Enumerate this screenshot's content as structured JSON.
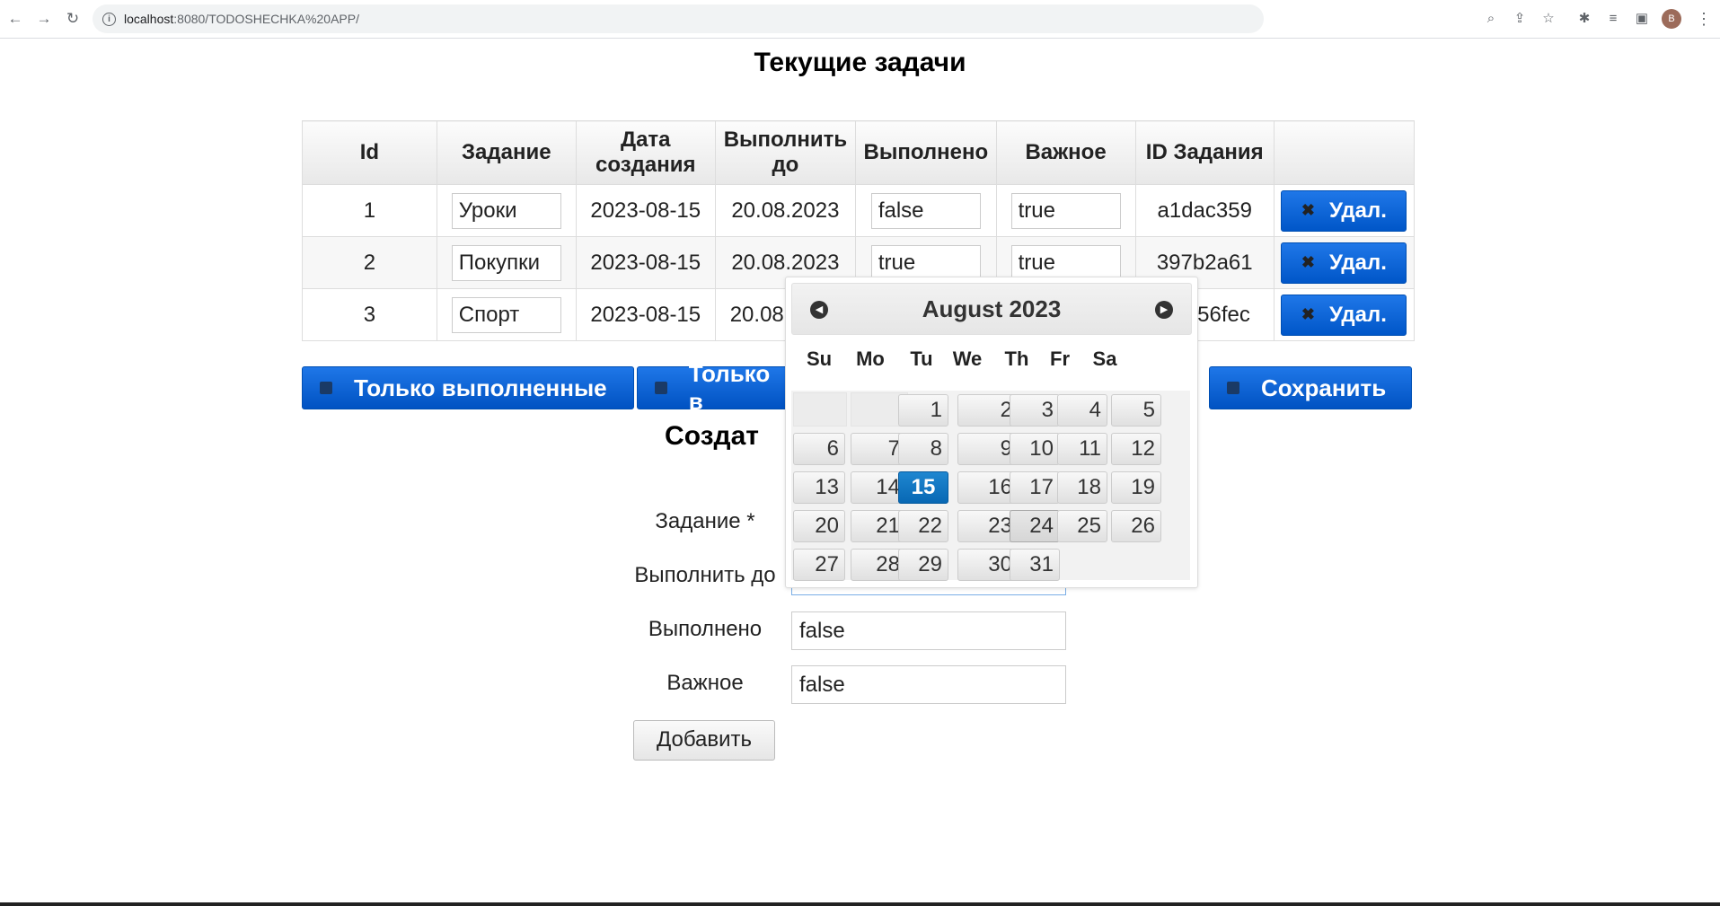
{
  "browser": {
    "url_host": "localhost",
    "url_path": ":8080/TODOSHECHKA%20APP/",
    "avatar_letter": "B",
    "icons": [
      "back-icon",
      "forward-icon",
      "reload-icon",
      "info-icon",
      "zoom-icon",
      "share-icon",
      "star-icon",
      "extensions-icon",
      "media-icon",
      "sidebar-icon",
      "avatar",
      "more-icon"
    ]
  },
  "page_title": "Текущие задачи",
  "table": {
    "headers": [
      "Id",
      "Задание",
      "Дата создания",
      "Выполнить до",
      "Выполнено",
      "Важное",
      "ID Задания",
      ""
    ],
    "rows": [
      {
        "id": "1",
        "task": "Уроки",
        "created": "2023-08-15",
        "due": "20.08.2023",
        "done": "false",
        "important": "true",
        "task_id": "a1dac359",
        "delete": "Удал."
      },
      {
        "id": "2",
        "task": "Покупки",
        "created": "2023-08-15",
        "due": "20.08.2023",
        "done": "true",
        "important": "true",
        "task_id": "397b2a61",
        "delete": "Удал."
      },
      {
        "id": "3",
        "task": "Спорт",
        "created": "2023-08-15",
        "due": "20.08",
        "done": "",
        "important": "",
        "task_id": "56fec",
        "delete": "Удал."
      }
    ]
  },
  "buttons": {
    "only_done": "Только выполненные",
    "only_second": "Только в",
    "save": "Сохранить"
  },
  "create_title": "Создат",
  "form": {
    "task_label": "Задание *",
    "due_label": "Выполнить до",
    "done_label": "Выполнено",
    "done_value": "false",
    "important_label": "Важное",
    "important_value": "false",
    "add_button": "Добавить"
  },
  "datepicker": {
    "title": "August 2023",
    "weekdays": [
      "Su",
      "Mo",
      "Tu",
      "We",
      "Th",
      "Fr",
      "Sa"
    ],
    "days": [
      "1",
      "2",
      "3",
      "4",
      "5",
      "6",
      "7",
      "8",
      "9",
      "10",
      "11",
      "12",
      "13",
      "14",
      "15",
      "16",
      "17",
      "18",
      "19",
      "20",
      "21",
      "22",
      "23",
      "24",
      "25",
      "26",
      "27",
      "28",
      "29",
      "30",
      "31"
    ],
    "selected_day": "15",
    "hovered_day": "24",
    "first_weekday_index": 2
  },
  "colors": {
    "accent_blue": "#0a66d6",
    "selected_day": "#0b70bd"
  }
}
